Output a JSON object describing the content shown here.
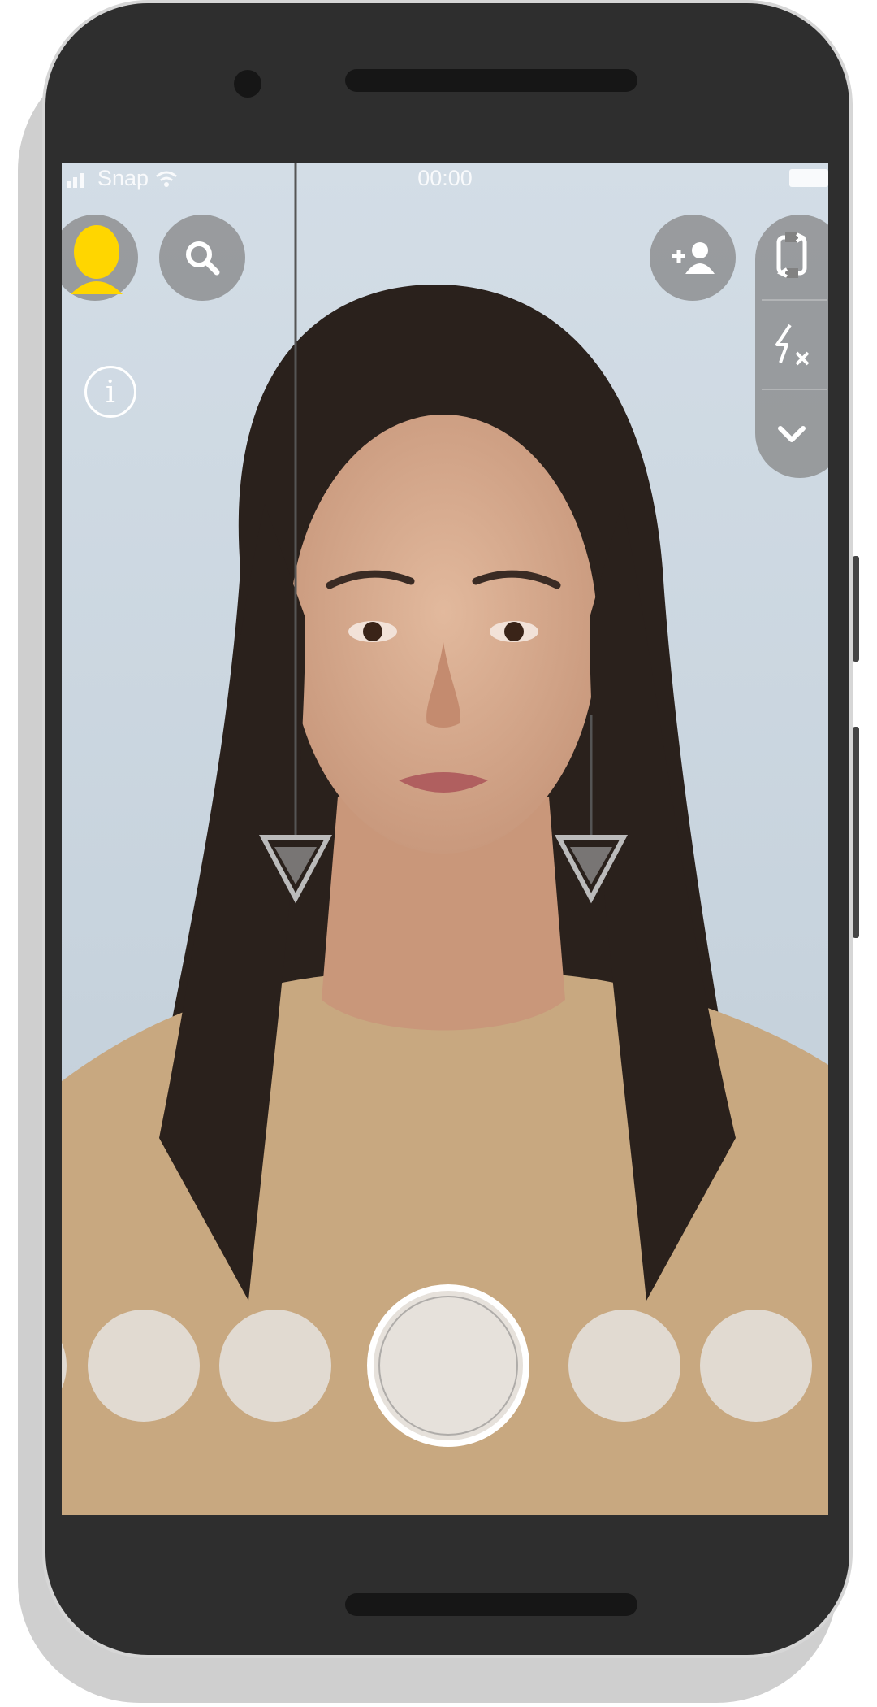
{
  "status_bar": {
    "carrier": "Snap",
    "time": "00:00"
  },
  "top_left": {
    "profile": "bitmoji-avatar",
    "search": "search-icon"
  },
  "top_right": {
    "add_friend": "add-friend-icon",
    "tray": [
      "flip-camera-icon",
      "flash-off-icon",
      "chevron-down-icon"
    ]
  },
  "lens_carousel": {
    "items_visible": 5,
    "selected_index": 2
  },
  "colors": {
    "accent_yellow": "#FFD600",
    "button_overlay": "#828282",
    "bezel": "#2e2e2e"
  }
}
